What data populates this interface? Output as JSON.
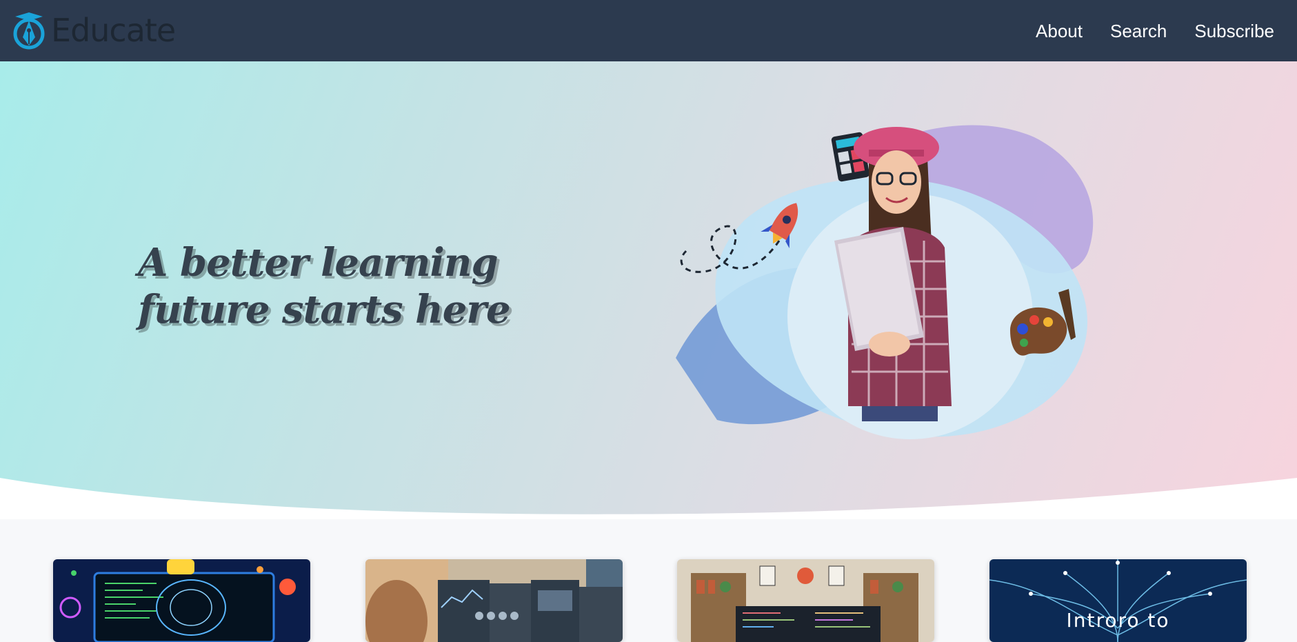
{
  "brand": {
    "name": "Educate",
    "logo_icon": "graduation-pen-icon",
    "color": "#1aa3d9"
  },
  "nav": {
    "links": [
      "About",
      "Search",
      "Subscribe"
    ]
  },
  "hero": {
    "heading_line1": "A better learning",
    "heading_line2": "future starts here",
    "illustration": "student-with-laptop-image",
    "decor_icons": [
      "calculator-icon",
      "rocket-icon",
      "paint-palette-icon"
    ]
  },
  "cards": [
    {
      "image": "python-ai-code-image",
      "caption": ""
    },
    {
      "image": "data-analyst-dashboard-image",
      "caption": ""
    },
    {
      "image": "developer-workspace-image",
      "caption": ""
    },
    {
      "image": "neural-tree-image",
      "caption": "Introro to"
    }
  ],
  "colors": {
    "navbar": "#2c3a4f",
    "heading": "#36424e"
  }
}
